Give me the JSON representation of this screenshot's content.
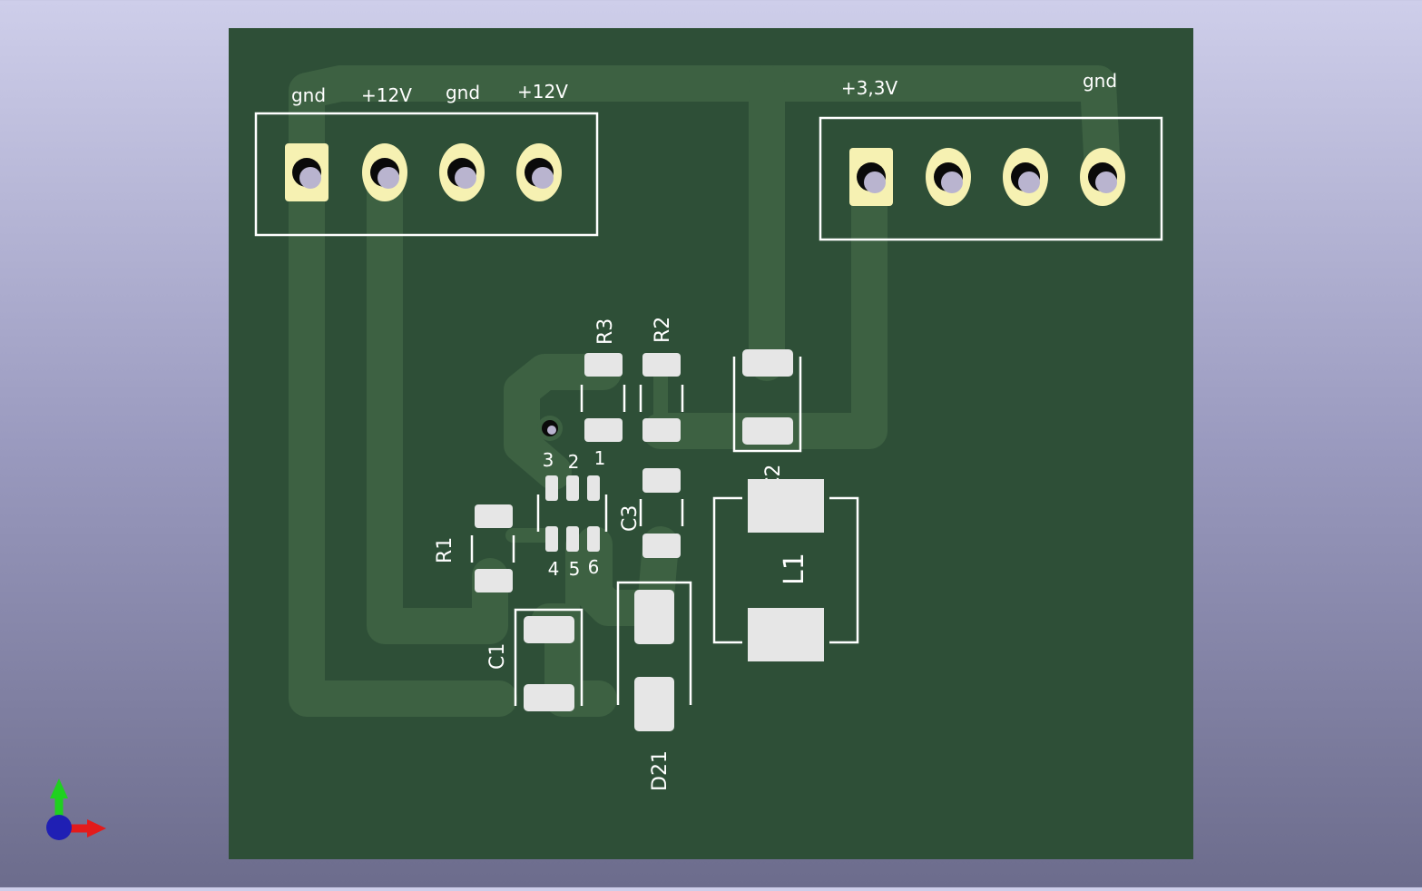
{
  "colors": {
    "board": "#2e4f37",
    "trace": "#3d6142",
    "pad": "#e6e6e6",
    "ring": "#f6f1b2",
    "axis_x": "#e31b1b",
    "axis_y": "#1fd11f",
    "axis_z": "#1f1fb4"
  },
  "connectors": {
    "left_labels": [
      "gnd",
      "+12V",
      "gnd",
      "+12V"
    ],
    "right_labels": [
      "+3,3V",
      "gnd"
    ]
  },
  "components": {
    "r1": "R1",
    "r2": "R2",
    "r3": "R3",
    "c1": "C1",
    "c2": "C2",
    "c3": "C3",
    "l1": "L1",
    "d21": "D21",
    "ic_pins_top": [
      "3",
      "2",
      "1"
    ],
    "ic_pins_bottom": [
      "4",
      "5",
      "6"
    ]
  },
  "axes": [
    "x-axis-arrow-icon",
    "y-axis-arrow-icon",
    "z-axis-dot-icon"
  ]
}
